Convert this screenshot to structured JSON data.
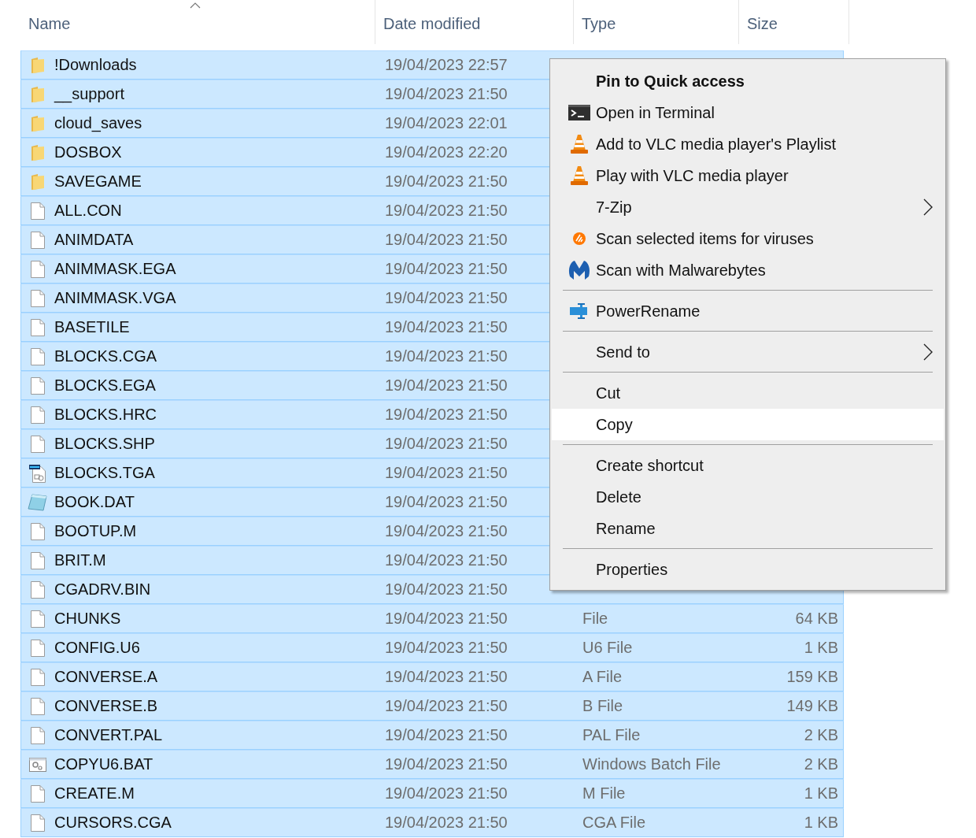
{
  "columns": [
    {
      "label": "Name",
      "sorted": true
    },
    {
      "label": "Date modified"
    },
    {
      "label": "Type"
    },
    {
      "label": "Size"
    }
  ],
  "rows": [
    {
      "kind": "folder",
      "name": "!Downloads",
      "date": "19/04/2023 22:57",
      "selected": true
    },
    {
      "kind": "folder",
      "name": "__support",
      "date": "19/04/2023 21:50",
      "selected": true
    },
    {
      "kind": "folder",
      "name": "cloud_saves",
      "date": "19/04/2023 22:01",
      "selected": true
    },
    {
      "kind": "folder",
      "name": "DOSBOX",
      "date": "19/04/2023 22:20",
      "selected": true
    },
    {
      "kind": "folder",
      "name": "SAVEGAME",
      "date": "19/04/2023 21:50",
      "selected": true
    },
    {
      "kind": "file",
      "name": "ALL.CON",
      "date": "19/04/2023 21:50",
      "selected": true
    },
    {
      "kind": "file",
      "name": "ANIMDATA",
      "date": "19/04/2023 21:50",
      "selected": true
    },
    {
      "kind": "file",
      "name": "ANIMMASK.EGA",
      "date": "19/04/2023 21:50",
      "selected": true
    },
    {
      "kind": "file",
      "name": "ANIMMASK.VGA",
      "date": "19/04/2023 21:50",
      "selected": true
    },
    {
      "kind": "file",
      "name": "BASETILE",
      "date": "19/04/2023 21:50",
      "selected": true
    },
    {
      "kind": "file",
      "name": "BLOCKS.CGA",
      "date": "19/04/2023 21:50",
      "selected": true
    },
    {
      "kind": "file",
      "name": "BLOCKS.EGA",
      "date": "19/04/2023 21:50",
      "selected": true
    },
    {
      "kind": "file",
      "name": "BLOCKS.HRC",
      "date": "19/04/2023 21:50",
      "selected": true
    },
    {
      "kind": "file",
      "name": "BLOCKS.SHP",
      "date": "19/04/2023 21:50",
      "selected": true
    },
    {
      "kind": "image",
      "name": "BLOCKS.TGA",
      "date": "19/04/2023 21:50",
      "selected": true
    },
    {
      "kind": "notepad",
      "name": "BOOK.DAT",
      "date": "19/04/2023 21:50",
      "selected": true
    },
    {
      "kind": "file",
      "name": "BOOTUP.M",
      "date": "19/04/2023 21:50",
      "selected": true
    },
    {
      "kind": "file",
      "name": "BRIT.M",
      "date": "19/04/2023 21:50",
      "selected": true
    },
    {
      "kind": "file",
      "name": "CGADRV.BIN",
      "date": "19/04/2023 21:50",
      "selected": true
    },
    {
      "kind": "file",
      "name": "CHUNKS",
      "date": "19/04/2023 21:50",
      "type": "File",
      "size": "64 KB",
      "selected": true
    },
    {
      "kind": "file",
      "name": "CONFIG.U6",
      "date": "19/04/2023 21:50",
      "type": "U6 File",
      "size": "1 KB",
      "selected": true
    },
    {
      "kind": "file",
      "name": "CONVERSE.A",
      "date": "19/04/2023 21:50",
      "type": "A File",
      "size": "159 KB",
      "selected": true
    },
    {
      "kind": "file",
      "name": "CONVERSE.B",
      "date": "19/04/2023 21:50",
      "type": "B File",
      "size": "149 KB",
      "selected": true
    },
    {
      "kind": "file",
      "name": "CONVERT.PAL",
      "date": "19/04/2023 21:50",
      "type": "PAL File",
      "size": "2 KB",
      "selected": true
    },
    {
      "kind": "batch",
      "name": "COPYU6.BAT",
      "date": "19/04/2023 21:50",
      "type": "Windows Batch File",
      "size": "2 KB",
      "selected": true
    },
    {
      "kind": "file",
      "name": "CREATE.M",
      "date": "19/04/2023 21:50",
      "type": "M File",
      "size": "1 KB",
      "selected": true
    },
    {
      "kind": "file",
      "name": "CURSORS.CGA",
      "date": "19/04/2023 21:50",
      "type": "CGA File",
      "size": "1 KB",
      "selected": true
    }
  ],
  "context_menu": [
    {
      "kind": "plain",
      "label": "Pin to Quick access",
      "bold": true,
      "submenu": false,
      "selected": false
    },
    {
      "kind": "terminal",
      "label": "Open in Terminal",
      "bold": false,
      "submenu": false,
      "selected": false
    },
    {
      "kind": "cone",
      "label": "Add to VLC media player's Playlist",
      "bold": false,
      "submenu": false,
      "selected": false
    },
    {
      "kind": "cone",
      "label": "Play with VLC media player",
      "bold": false,
      "submenu": false,
      "selected": false
    },
    {
      "kind": "plain",
      "label": "7-Zip",
      "bold": false,
      "submenu": true,
      "selected": false
    },
    {
      "kind": "antivirus",
      "label": "Scan selected items for viruses",
      "bold": false,
      "submenu": false,
      "selected": false
    },
    {
      "kind": "mlogo",
      "label": "Scan with Malwarebytes",
      "bold": false,
      "submenu": false,
      "selected": false
    },
    {
      "kind": "separator"
    },
    {
      "kind": "rename",
      "label": "PowerRename",
      "bold": false,
      "submenu": false,
      "selected": false
    },
    {
      "kind": "separator"
    },
    {
      "kind": "plain",
      "label": "Send to",
      "bold": false,
      "submenu": true,
      "selected": false
    },
    {
      "kind": "separator"
    },
    {
      "kind": "plain",
      "label": "Cut",
      "bold": false,
      "submenu": false,
      "selected": false
    },
    {
      "kind": "plain",
      "label": "Copy",
      "bold": false,
      "submenu": false,
      "selected": true
    },
    {
      "kind": "separator"
    },
    {
      "kind": "plain",
      "label": "Create shortcut",
      "bold": false,
      "submenu": false,
      "selected": false
    },
    {
      "kind": "plain",
      "label": "Delete",
      "bold": false,
      "submenu": false,
      "selected": false
    },
    {
      "kind": "plain",
      "label": "Rename",
      "bold": false,
      "submenu": false,
      "selected": false
    },
    {
      "kind": "separator"
    },
    {
      "kind": "plain",
      "label": "Properties",
      "bold": false,
      "submenu": false,
      "selected": false
    }
  ]
}
